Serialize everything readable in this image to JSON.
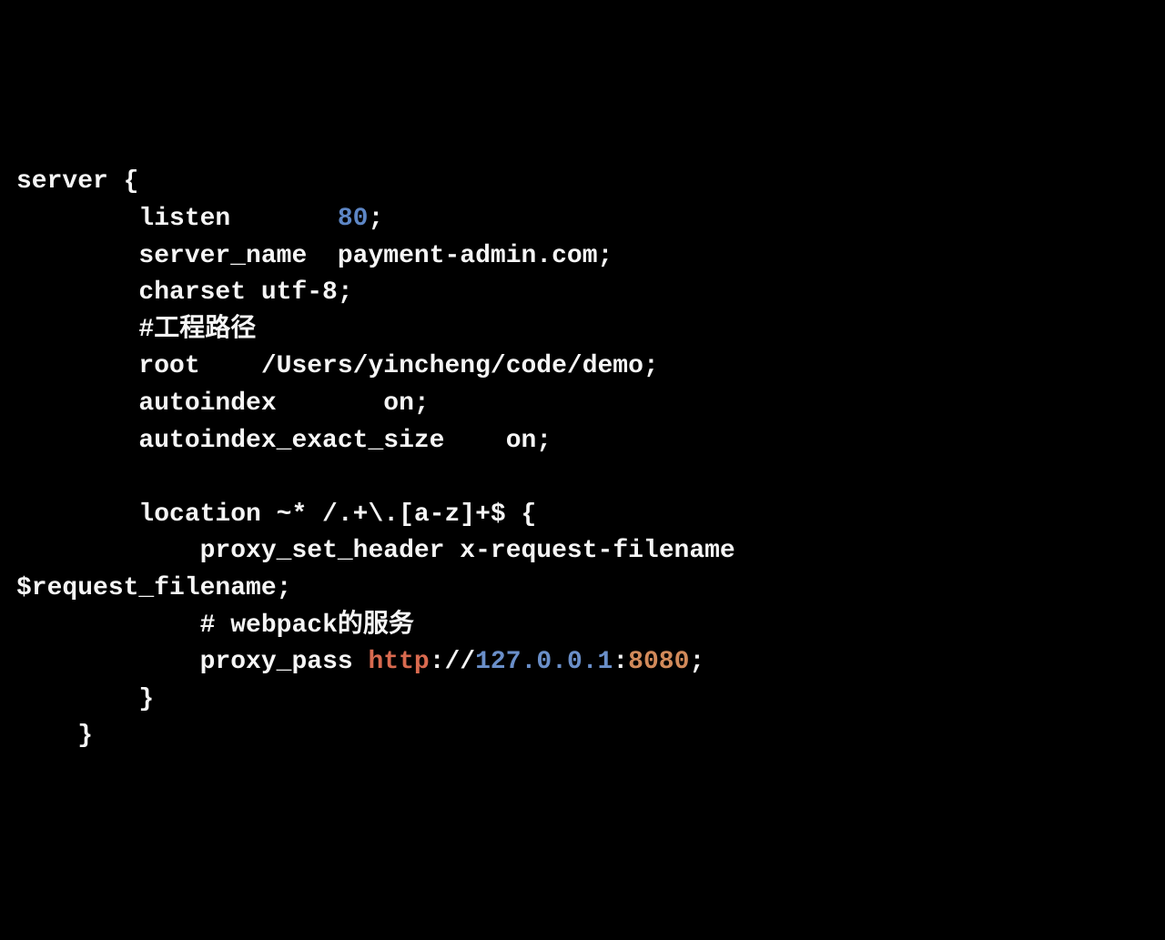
{
  "code": {
    "lines": [
      {
        "indent": "",
        "segments": [
          {
            "text": "server {",
            "cls": "tok-plain"
          }
        ]
      },
      {
        "indent": "        ",
        "segments": [
          {
            "text": "listen       ",
            "cls": "tok-plain"
          },
          {
            "text": "80",
            "cls": "tok-number"
          },
          {
            "text": ";",
            "cls": "tok-plain"
          }
        ]
      },
      {
        "indent": "        ",
        "segments": [
          {
            "text": "server_name  payment-admin.com;",
            "cls": "tok-plain"
          }
        ]
      },
      {
        "indent": "        ",
        "segments": [
          {
            "text": "charset utf-8;",
            "cls": "tok-plain"
          }
        ]
      },
      {
        "indent": "        ",
        "segments": [
          {
            "text": "#工程路径",
            "cls": "tok-plain"
          }
        ]
      },
      {
        "indent": "        ",
        "segments": [
          {
            "text": "root    /Users/yincheng/code/demo;",
            "cls": "tok-plain"
          }
        ]
      },
      {
        "indent": "        ",
        "segments": [
          {
            "text": "autoindex       on;",
            "cls": "tok-plain"
          }
        ]
      },
      {
        "indent": "        ",
        "segments": [
          {
            "text": "autoindex_exact_size    on;",
            "cls": "tok-plain"
          }
        ]
      },
      {
        "indent": "",
        "segments": [
          {
            "text": "",
            "cls": "tok-plain"
          }
        ]
      },
      {
        "indent": "        ",
        "segments": [
          {
            "text": "location ~* /.+\\.[a-z]+$ {",
            "cls": "tok-plain"
          }
        ]
      },
      {
        "indent": "            ",
        "segments": [
          {
            "text": "proxy_set_header x-request-filename",
            "cls": "tok-plain"
          }
        ]
      },
      {
        "indent": "",
        "segments": [
          {
            "text": "$request_filename;",
            "cls": "tok-plain"
          }
        ]
      },
      {
        "indent": "            ",
        "segments": [
          {
            "text": "# webpack的服务",
            "cls": "tok-plain"
          }
        ]
      },
      {
        "indent": "            ",
        "segments": [
          {
            "text": "proxy_pass ",
            "cls": "tok-plain"
          },
          {
            "text": "http",
            "cls": "tok-keyword"
          },
          {
            "text": "://",
            "cls": "tok-plain"
          },
          {
            "text": "127.0.0.1",
            "cls": "tok-ip"
          },
          {
            "text": ":",
            "cls": "tok-plain"
          },
          {
            "text": "8080",
            "cls": "tok-port"
          },
          {
            "text": ";",
            "cls": "tok-plain"
          }
        ]
      },
      {
        "indent": "        ",
        "segments": [
          {
            "text": "}",
            "cls": "tok-plain"
          }
        ]
      },
      {
        "indent": "    ",
        "segments": [
          {
            "text": "}",
            "cls": "tok-plain"
          }
        ]
      }
    ]
  }
}
